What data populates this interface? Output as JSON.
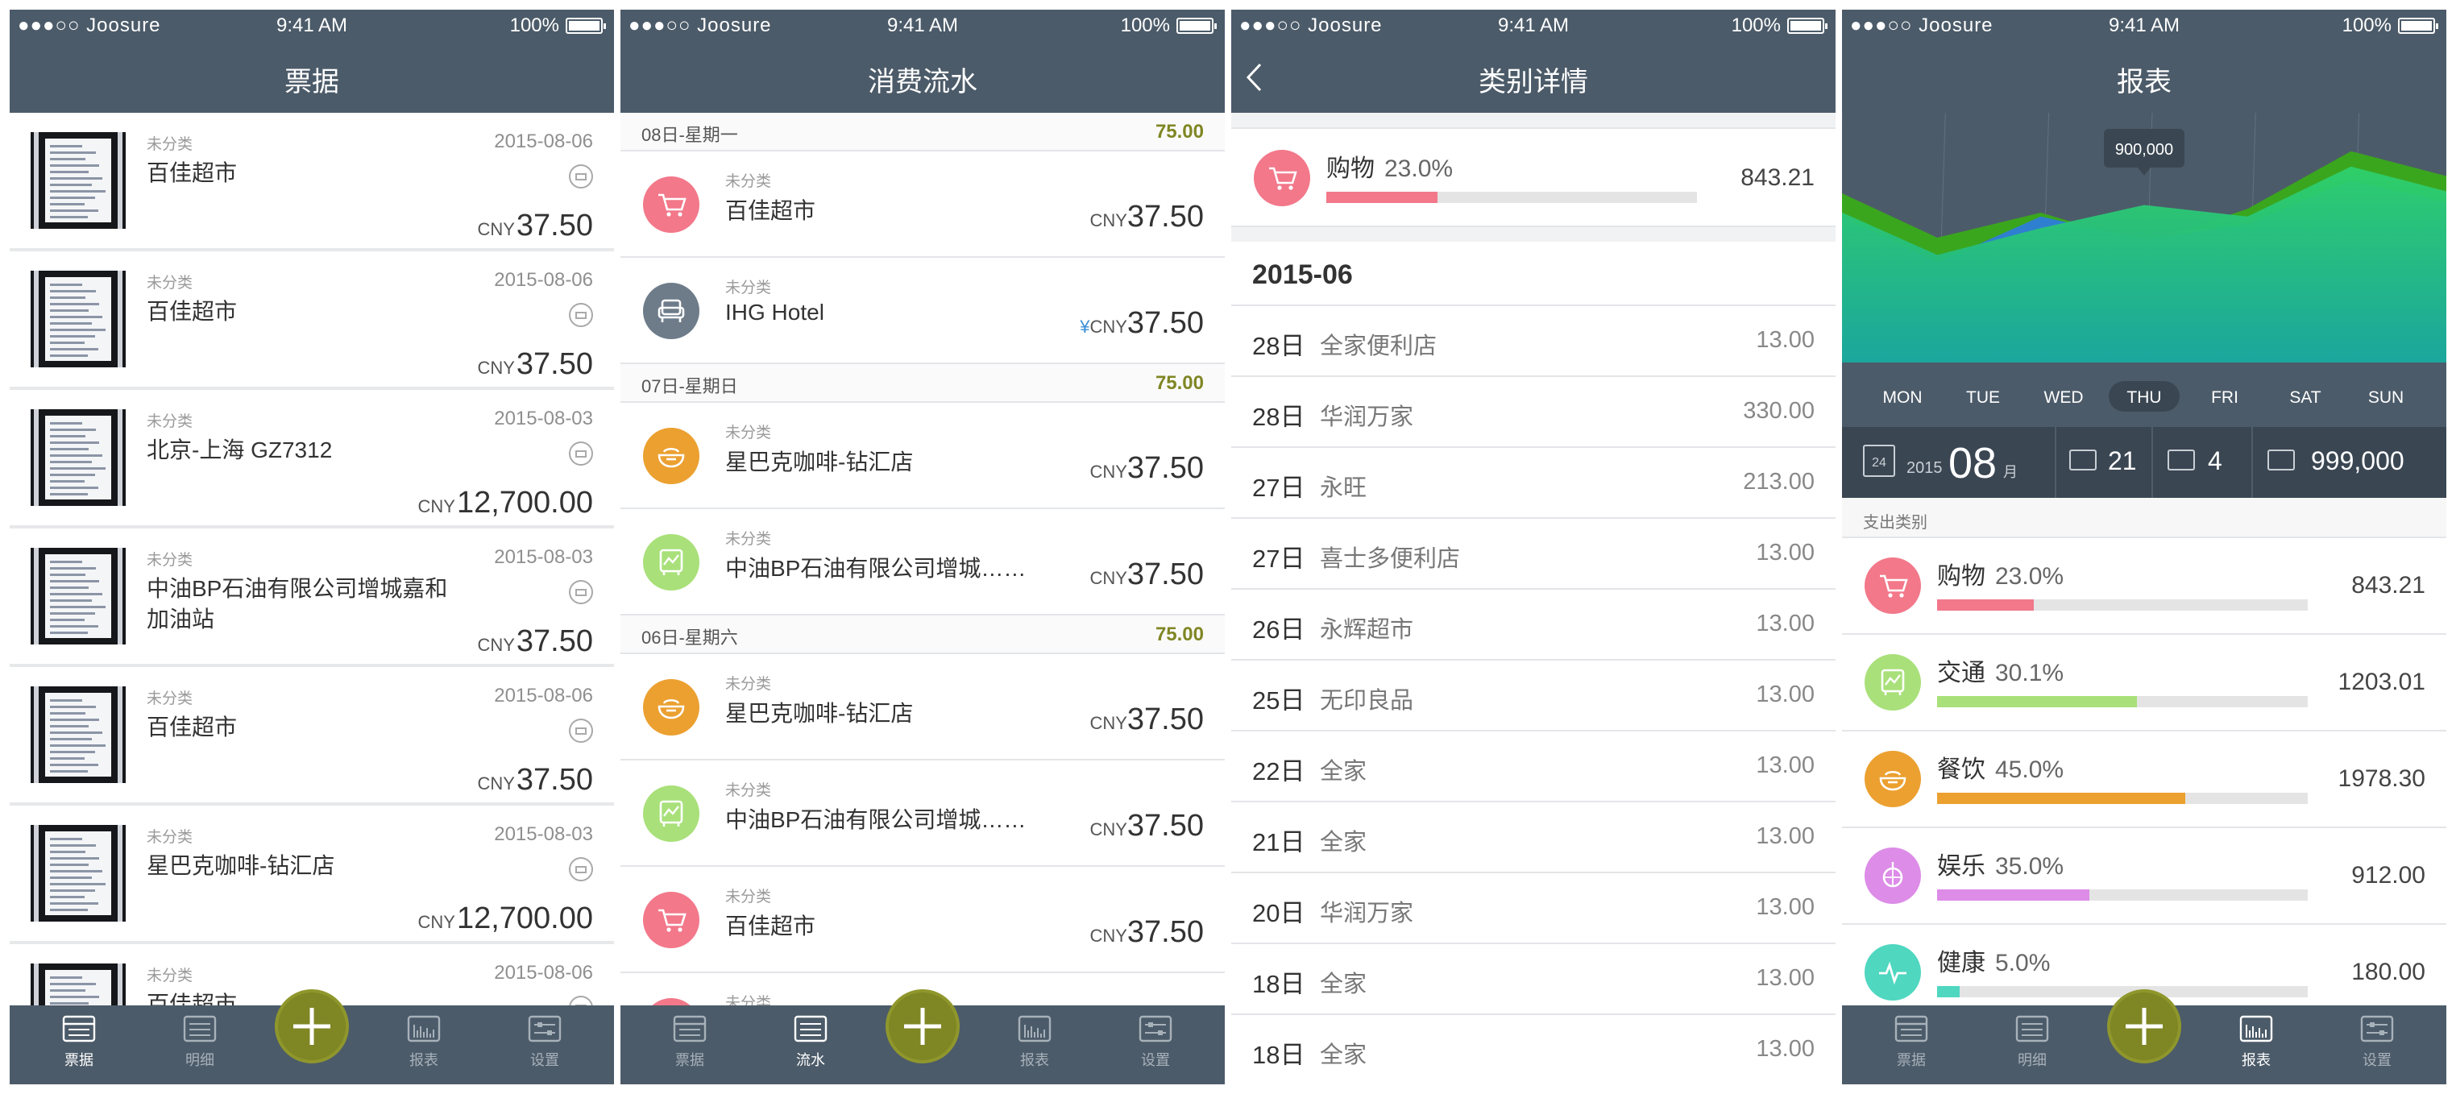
{
  "status": {
    "carrier": "●●●○○ Joosure",
    "time": "9:41 AM",
    "battery": "100%"
  },
  "colors": {
    "navbar": "#4c5b69",
    "accent": "#7f8624",
    "pink": "#f2788a",
    "green": "#a9e07a",
    "orange": "#eba030",
    "purple": "#dd8ce8",
    "teal": "#4fd7c0",
    "gray": "#6e7c8a"
  },
  "screen1": {
    "title": "票据",
    "receipts": [
      {
        "category": "未分类",
        "name": "百佳超市",
        "date": "2015-08-06",
        "currency": "CNY",
        "amount": "37.50"
      },
      {
        "category": "未分类",
        "name": "百佳超市",
        "date": "2015-08-06",
        "currency": "CNY",
        "amount": "37.50"
      },
      {
        "category": "未分类",
        "name": "北京-上海 GZ7312",
        "date": "2015-08-03",
        "currency": "CNY",
        "amount": "12,700.00"
      },
      {
        "category": "未分类",
        "name": "中油BP石油有限公司增城嘉和加油站",
        "date": "2015-08-03",
        "currency": "CNY",
        "amount": "37.50"
      },
      {
        "category": "未分类",
        "name": "百佳超市",
        "date": "2015-08-06",
        "currency": "CNY",
        "amount": "37.50"
      },
      {
        "category": "未分类",
        "name": "星巴克咖啡-钻汇店",
        "date": "2015-08-03",
        "currency": "CNY",
        "amount": "12,700.00"
      },
      {
        "category": "未分类",
        "name": "百佳超市",
        "date": "2015-08-06",
        "currency": "CNY",
        "amount": "37.50"
      }
    ],
    "tabs": [
      "票据",
      "明细",
      "报表",
      "设置"
    ],
    "active_tab": "票据"
  },
  "screen2": {
    "title": "消费流水",
    "days": [
      {
        "label": "08日-星期一",
        "total": "75.00",
        "items": [
          {
            "category": "未分类",
            "name": "百佳超市",
            "currency": "CNY",
            "amount": "37.50",
            "icon": "cart-icon",
            "color": "#f2788a"
          },
          {
            "category": "未分类",
            "name": "IHG Hotel",
            "currency": "CNY",
            "prefix": "¥",
            "amount": "37.50",
            "icon": "sofa-icon",
            "color": "#6e7c8a"
          }
        ]
      },
      {
        "label": "07日-星期日",
        "total": "75.00",
        "items": [
          {
            "category": "未分类",
            "name": "星巴克咖啡-钻汇店",
            "currency": "CNY",
            "amount": "37.50",
            "icon": "bowl-icon",
            "color": "#eba030"
          },
          {
            "category": "未分类",
            "name": "中油BP石油有限公司增城……",
            "currency": "CNY",
            "amount": "37.50",
            "icon": "bus-icon",
            "color": "#a9e07a"
          }
        ]
      },
      {
        "label": "06日-星期六",
        "total": "75.00",
        "items": [
          {
            "category": "未分类",
            "name": "星巴克咖啡-钻汇店",
            "currency": "CNY",
            "amount": "37.50",
            "icon": "bowl-icon",
            "color": "#eba030"
          },
          {
            "category": "未分类",
            "name": "中油BP石油有限公司增城……",
            "currency": "CNY",
            "amount": "37.50",
            "icon": "bus-icon",
            "color": "#a9e07a"
          },
          {
            "category": "未分类",
            "name": "百佳超市",
            "currency": "CNY",
            "amount": "37.50",
            "icon": "cart-icon",
            "color": "#f2788a"
          },
          {
            "category": "未分类",
            "name": "",
            "currency": "",
            "amount": "",
            "icon": "cart-icon",
            "color": "#f2788a"
          }
        ]
      }
    ],
    "tabs": [
      "票据",
      "流水",
      "报表",
      "设置"
    ],
    "active_tab": "流水"
  },
  "screen3": {
    "title": "类别详情",
    "summary": {
      "name": "购物",
      "percent": "23.0%",
      "fraction": 0.3,
      "value": "843.21",
      "color": "#f2788a"
    },
    "month": "2015-06",
    "entries": [
      {
        "day": "28日",
        "name": "全家便利店",
        "value": "13.00"
      },
      {
        "day": "28日",
        "name": "华润万家",
        "value": "330.00"
      },
      {
        "day": "27日",
        "name": "永旺",
        "value": "213.00"
      },
      {
        "day": "27日",
        "name": "喜士多便利店",
        "value": "13.00"
      },
      {
        "day": "26日",
        "name": "永辉超市",
        "value": "13.00"
      },
      {
        "day": "25日",
        "name": "无印良品",
        "value": "13.00"
      },
      {
        "day": "22日",
        "name": "全家",
        "value": "13.00"
      },
      {
        "day": "21日",
        "name": "全家",
        "value": "13.00"
      },
      {
        "day": "20日",
        "name": "华润万家",
        "value": "13.00"
      },
      {
        "day": "18日",
        "name": "全家",
        "value": "13.00"
      },
      {
        "day": "18日",
        "name": "全家",
        "value": "13.00"
      }
    ]
  },
  "screen4": {
    "title": "报表",
    "tooltip": "900,000",
    "days": [
      "MON",
      "TUE",
      "WED",
      "THU",
      "FRI",
      "SAT",
      "SUN"
    ],
    "active_day": "THU",
    "stats": {
      "calendar_day": "24",
      "year": "2015",
      "month": "08",
      "month_unit": "月",
      "wallet_count": "21",
      "card_count": "4",
      "cash_total": "999,000"
    },
    "section_label": "支出类别",
    "categories": [
      {
        "name": "购物",
        "percent": "23.0%",
        "fraction": 0.26,
        "value": "843.21",
        "color": "#f2788a",
        "icon": "cart-icon"
      },
      {
        "name": "交通",
        "percent": "30.1%",
        "fraction": 0.54,
        "value": "1203.01",
        "color": "#a9e07a",
        "icon": "bus-icon"
      },
      {
        "name": "餐饮",
        "percent": "45.0%",
        "fraction": 0.67,
        "value": "1978.30",
        "color": "#eba030",
        "icon": "bowl-icon"
      },
      {
        "name": "娱乐",
        "percent": "35.0%",
        "fraction": 0.41,
        "value": "912.00",
        "color": "#dd8ce8",
        "icon": "disco-icon"
      },
      {
        "name": "健康",
        "percent": "5.0%",
        "fraction": 0.06,
        "value": "180.00",
        "color": "#4fd7c0",
        "icon": "pulse-icon"
      }
    ],
    "tabs": [
      "票据",
      "明细",
      "报表",
      "设置"
    ],
    "active_tab": "报表"
  },
  "chart_data": {
    "type": "area",
    "categories": [
      "MON",
      "TUE",
      "WED",
      "THU",
      "FRI",
      "SAT",
      "SUN"
    ],
    "series": [
      {
        "values": [
          900000,
          650000,
          780000,
          620000,
          800000,
          1100000,
          960000
        ]
      },
      {
        "values": [
          780000,
          520000,
          760000,
          640000,
          720000,
          950000,
          820000
        ]
      },
      {
        "values": [
          800000,
          560000,
          700000,
          820000,
          760000,
          1020000,
          880000
        ]
      }
    ],
    "annotation": "900,000",
    "grid": true
  }
}
